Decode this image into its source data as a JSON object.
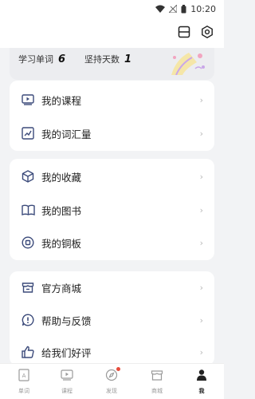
{
  "status_bar": {
    "time": "10:20"
  },
  "stats": [
    {
      "label": "学习单词",
      "value": "6"
    },
    {
      "label": "坚持天数",
      "value": "1"
    }
  ],
  "menu_groups": [
    {
      "items": [
        {
          "label": "我的课程",
          "icon": "video-lesson-icon"
        },
        {
          "label": "我的词汇量",
          "icon": "chart-trend-icon"
        }
      ]
    },
    {
      "items": [
        {
          "label": "我的收藏",
          "icon": "cube-icon"
        },
        {
          "label": "我的图书",
          "icon": "book-icon"
        },
        {
          "label": "我的铜板",
          "icon": "coin-icon"
        }
      ]
    },
    {
      "items": [
        {
          "label": "官方商城",
          "icon": "store-icon"
        },
        {
          "label": "帮助与反馈",
          "icon": "help-icon"
        },
        {
          "label": "给我们好评",
          "icon": "thumbs-up-icon"
        }
      ]
    }
  ],
  "arrow": "›",
  "tabs": [
    {
      "label": "单词",
      "icon": "word-icon",
      "active": false
    },
    {
      "label": "课程",
      "icon": "lesson-icon",
      "active": false
    },
    {
      "label": "发现",
      "icon": "compass-icon",
      "active": false,
      "badge": true
    },
    {
      "label": "商城",
      "icon": "shop-icon",
      "active": false
    },
    {
      "label": "我",
      "icon": "profile-icon",
      "active": true
    }
  ],
  "colors": {
    "background": "#f2f3f5",
    "card": "#ffffff",
    "accent": "#3b4a7a",
    "badge": "#e74c3c"
  }
}
